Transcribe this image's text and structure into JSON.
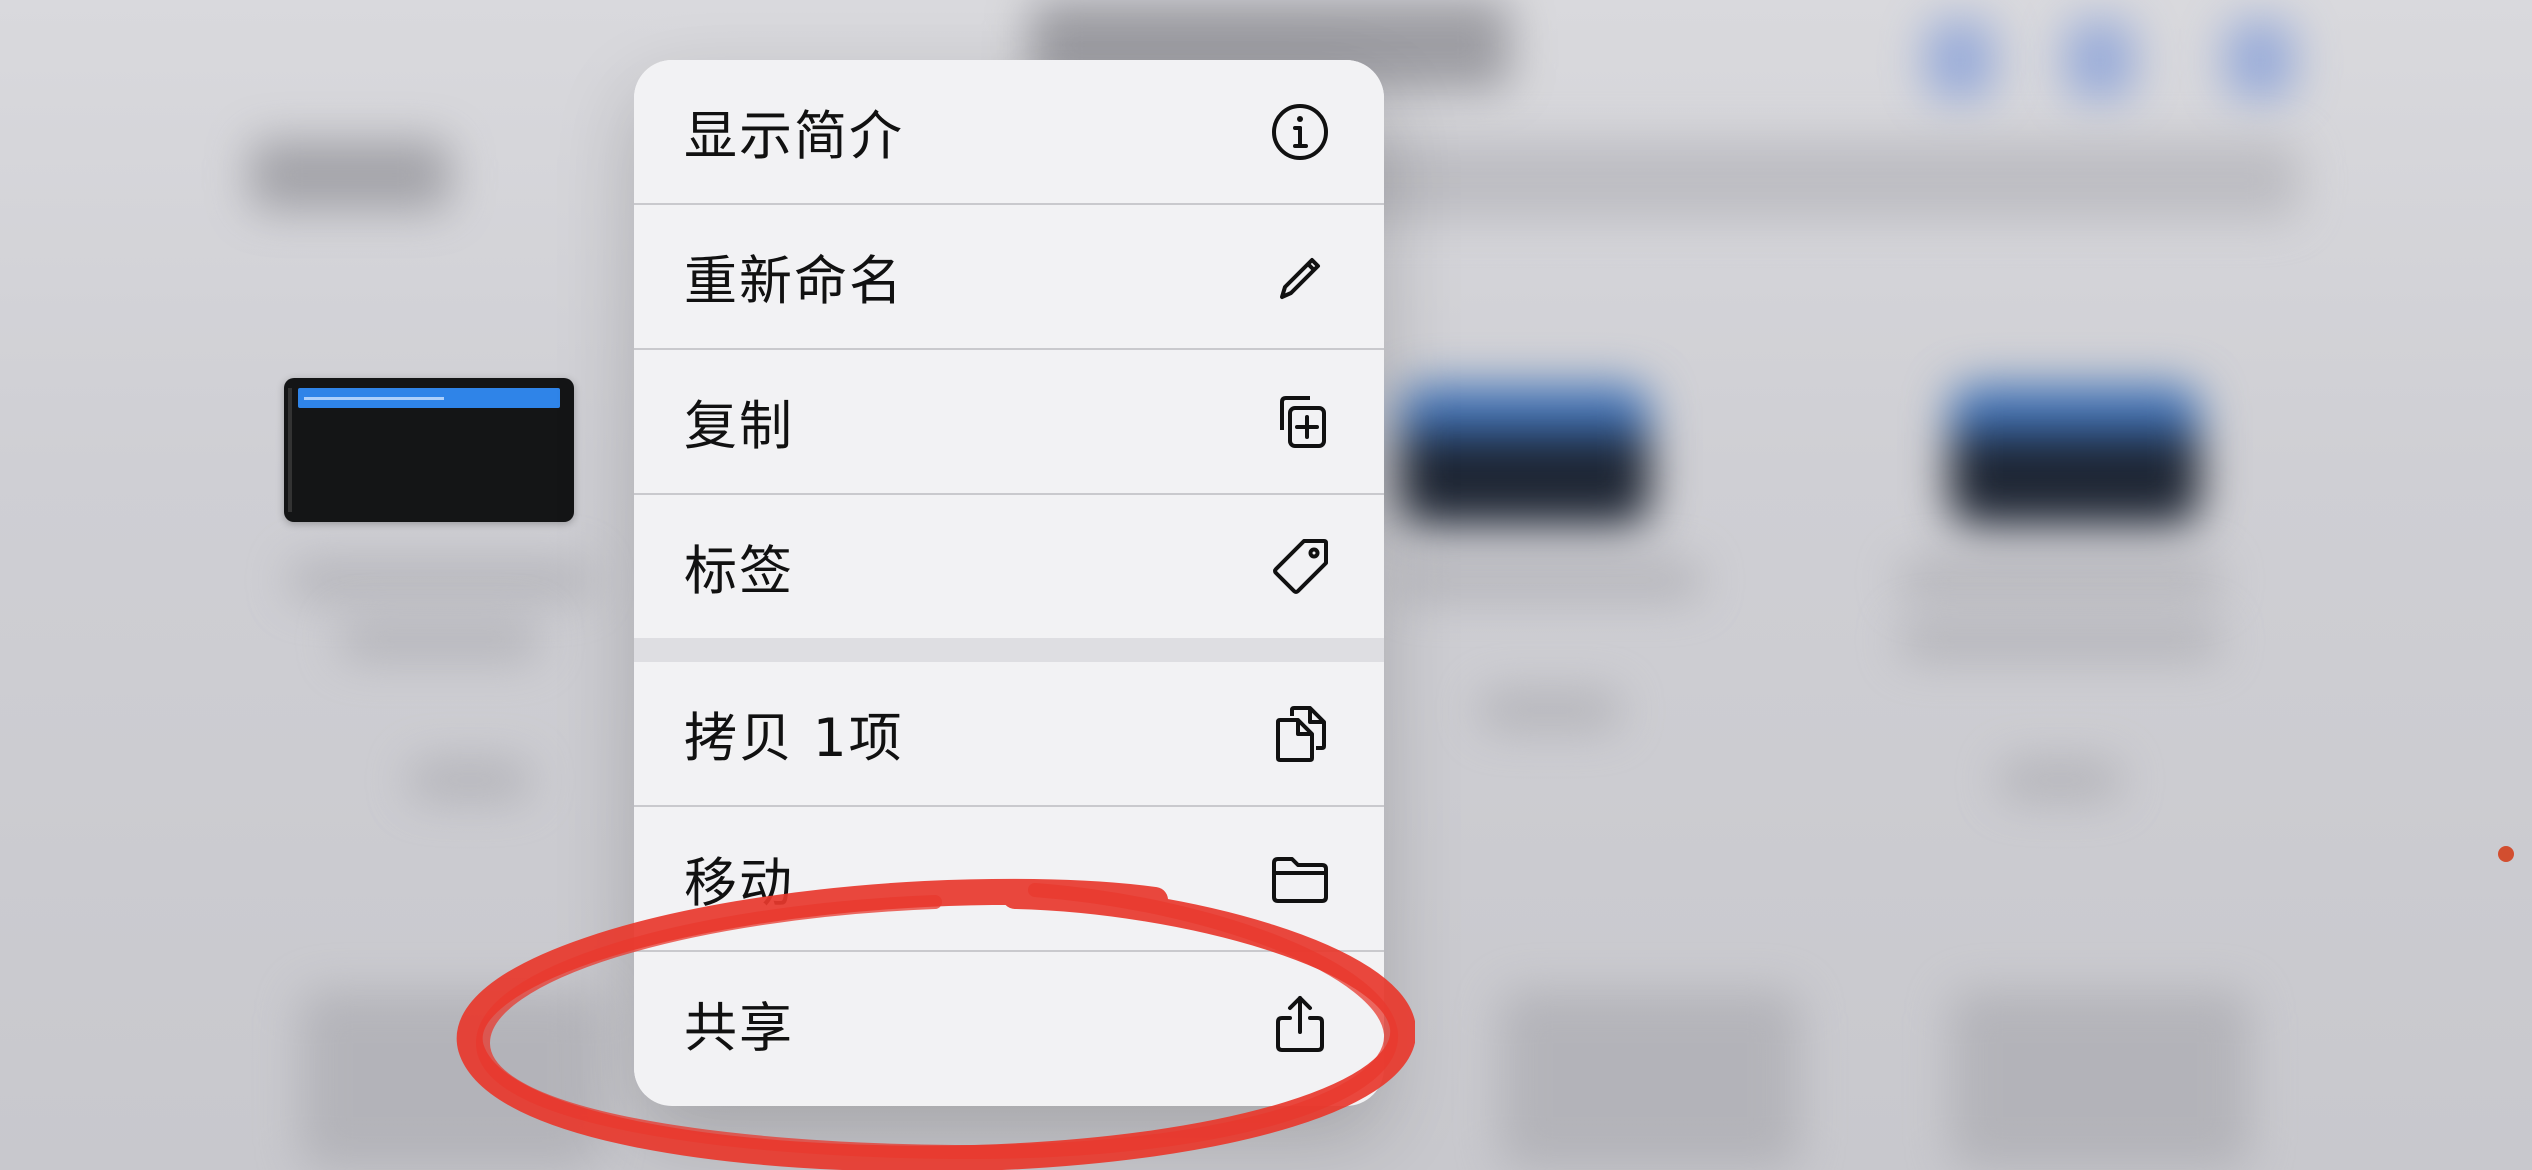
{
  "menu": {
    "items": [
      {
        "label": "显示简介",
        "icon": "info-circle-icon"
      },
      {
        "label": "重新命名",
        "icon": "pencil-icon"
      },
      {
        "label": "复制",
        "icon": "duplicate-plus-icon"
      },
      {
        "label": "标签",
        "icon": "tag-icon"
      },
      {
        "label": "拷贝 1项",
        "icon": "copy-documents-icon"
      },
      {
        "label": "移动",
        "icon": "folder-icon"
      },
      {
        "label": "共享",
        "icon": "share-icon"
      }
    ]
  },
  "colors": {
    "menu_background": "#f2f2f4",
    "annotation_red": "#e8382d",
    "selection_blue": "#2f84e8"
  }
}
